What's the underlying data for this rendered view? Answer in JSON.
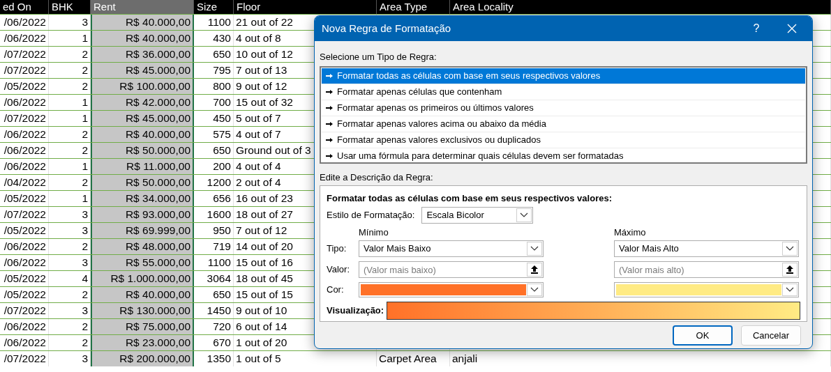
{
  "sheet": {
    "columns": [
      {
        "label": "ed On",
        "selected": false
      },
      {
        "label": "BHK",
        "selected": false
      },
      {
        "label": "Rent",
        "selected": true
      },
      {
        "label": "Size",
        "selected": false
      },
      {
        "label": "Floor",
        "selected": false
      },
      {
        "label": "Area Type",
        "selected": false
      },
      {
        "label": "Area Locality",
        "selected": false
      }
    ],
    "rows": [
      {
        "cells": [
          "/06/2022",
          "3",
          "R$ 40.000,00",
          "1100",
          "21 out of 22"
        ]
      },
      {
        "cells": [
          "/06/2022",
          "1",
          "R$ 40.000,00",
          "430",
          "4 out of 8"
        ]
      },
      {
        "cells": [
          "/07/2022",
          "2",
          "R$ 36.000,00",
          "650",
          "10 out of 12"
        ]
      },
      {
        "cells": [
          "/07/2022",
          "2",
          "R$ 45.000,00",
          "795",
          "7 out of 13"
        ]
      },
      {
        "cells": [
          "/05/2022",
          "2",
          "R$ 100.000,00",
          "800",
          "9 out of 12"
        ]
      },
      {
        "cells": [
          "/06/2022",
          "1",
          "R$ 42.000,00",
          "700",
          "15 out of 32"
        ]
      },
      {
        "cells": [
          "/07/2022",
          "1",
          "R$ 45.000,00",
          "450",
          "5 out of 7"
        ]
      },
      {
        "cells": [
          "/06/2022",
          "2",
          "R$ 40.000,00",
          "575",
          "4 out of 7"
        ]
      },
      {
        "cells": [
          "/06/2022",
          "2",
          "R$ 50.000,00",
          "650",
          "Ground out of 3"
        ]
      },
      {
        "cells": [
          "/06/2022",
          "1",
          "R$ 11.000,00",
          "200",
          "4 out of 4"
        ]
      },
      {
        "cells": [
          "/04/2022",
          "2",
          "R$ 50.000,00",
          "1200",
          "2 out of 4"
        ]
      },
      {
        "cells": [
          "/05/2022",
          "1",
          "R$ 34.000,00",
          "656",
          "16 out of 23"
        ]
      },
      {
        "cells": [
          "/07/2022",
          "3",
          "R$ 93.000,00",
          "1600",
          "18 out of 27"
        ]
      },
      {
        "cells": [
          "/05/2022",
          "3",
          "R$ 69.999,00",
          "950",
          "7 out of 12"
        ]
      },
      {
        "cells": [
          "/06/2022",
          "2",
          "R$ 48.000,00",
          "719",
          "14 out of 20"
        ]
      },
      {
        "cells": [
          "/06/2022",
          "3",
          "R$ 55.000,00",
          "1100",
          "15 out of 16"
        ]
      },
      {
        "cells": [
          "/05/2022",
          "4",
          "R$ 1.000.000,00",
          "3064",
          "18 out of 45"
        ]
      },
      {
        "cells": [
          "/05/2022",
          "2",
          "R$ 40.000,00",
          "650",
          "15 out of 15"
        ]
      },
      {
        "cells": [
          "/07/2022",
          "3",
          "R$ 130.000,00",
          "1450",
          "9 out of 10"
        ]
      },
      {
        "cells": [
          "/06/2022",
          "2",
          "R$ 75.000,00",
          "720",
          "6 out of 14"
        ]
      },
      {
        "cells": [
          "/06/2022",
          "2",
          "R$ 23.000,00",
          "670",
          "1 out of 20"
        ]
      },
      {
        "cells": [
          "/07/2022",
          "3",
          "R$ 200.000,00",
          "1350",
          "1 out of 5",
          "Carpet Area",
          "anjali"
        ]
      }
    ]
  },
  "dialog": {
    "title": "Nova Regra de Formatação",
    "help": "?",
    "rule_type_label": "Selecione um Tipo de Regra:",
    "rule_types": [
      {
        "label": "Formatar todas as células com base em seus respectivos valores",
        "selected": true
      },
      {
        "label": "Formatar apenas células que contenham",
        "selected": false
      },
      {
        "label": "Formatar apenas os primeiros ou últimos valores",
        "selected": false
      },
      {
        "label": "Formatar apenas valores acima ou abaixo da média",
        "selected": false
      },
      {
        "label": "Formatar apenas valores exclusivos ou duplicados",
        "selected": false
      },
      {
        "label": "Usar uma fórmula para determinar quais células devem ser formatadas",
        "selected": false
      }
    ],
    "description_label": "Edite a Descrição da Regra:",
    "description_heading": "Formatar todas as células com base em seus respectivos valores:",
    "style_label": "Estilo de Formatação:",
    "style_value": "Escala Bicolor",
    "type_label": "Tipo:",
    "value_label": "Valor:",
    "color_label": "Cor:",
    "minimum": {
      "heading": "Mínimo",
      "type": "Valor Mais Baixo",
      "value_placeholder": "(Valor mais baixo)",
      "color": "#ff7128"
    },
    "maximum": {
      "heading": "Máximo",
      "type": "Valor Mais Alto",
      "value_placeholder": "(Valor mais alto)",
      "color": "#ffeb84"
    },
    "preview_label": "Visualização:",
    "buttons": [
      "OK",
      "Cancelar"
    ]
  }
}
